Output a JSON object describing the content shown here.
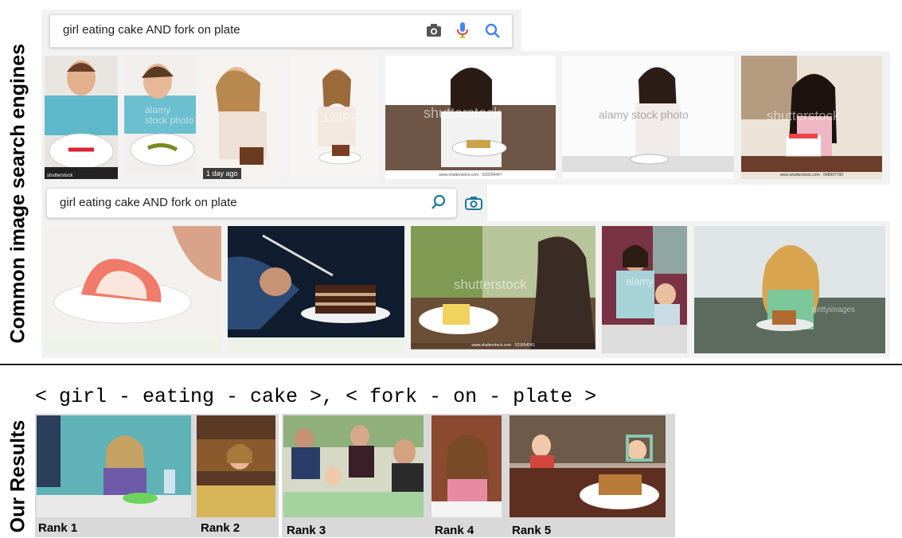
{
  "labels": {
    "common": "Common image search engines",
    "ours": "Our Results"
  },
  "search1": {
    "query": "girl eating cake AND fork on plate",
    "icons": [
      "camera-icon",
      "microphone-icon",
      "search-icon"
    ]
  },
  "search2": {
    "query": "girl eating cake AND fork on plate",
    "icons": [
      "search-icon",
      "camera-icon"
    ]
  },
  "row1_overlays": {
    "wm_alamy": "alamy\nstock photo",
    "wm_123": "123RF",
    "wm_ss": "shutterstock",
    "wm_alamy2": "alamy stock photo",
    "wm_ss2": "shutterstock",
    "badge": "1 day ago",
    "cap_shutter1": "shutterstock",
    "cap_ss1": "www.shutterstock.com · 529294447",
    "cap_ss2": "www.shutterstock.com · 548997790"
  },
  "row2_overlays": {
    "wm_ss3": "shutterstock",
    "wm_alamy3": "alamy",
    "wm_getty": "gettyimages",
    "cap_ss3": "www.shutterstock.com · 531854041"
  },
  "triple": "< girl - eating - cake >, < fork - on - plate >",
  "ranks": [
    "Rank 1",
    "Rank 2",
    "Rank 3",
    "Rank 4",
    "Rank 5"
  ],
  "colors": {
    "google_blue": "#4285f4",
    "google_red": "#ea4335",
    "bing_teal": "#1a7a9a"
  }
}
